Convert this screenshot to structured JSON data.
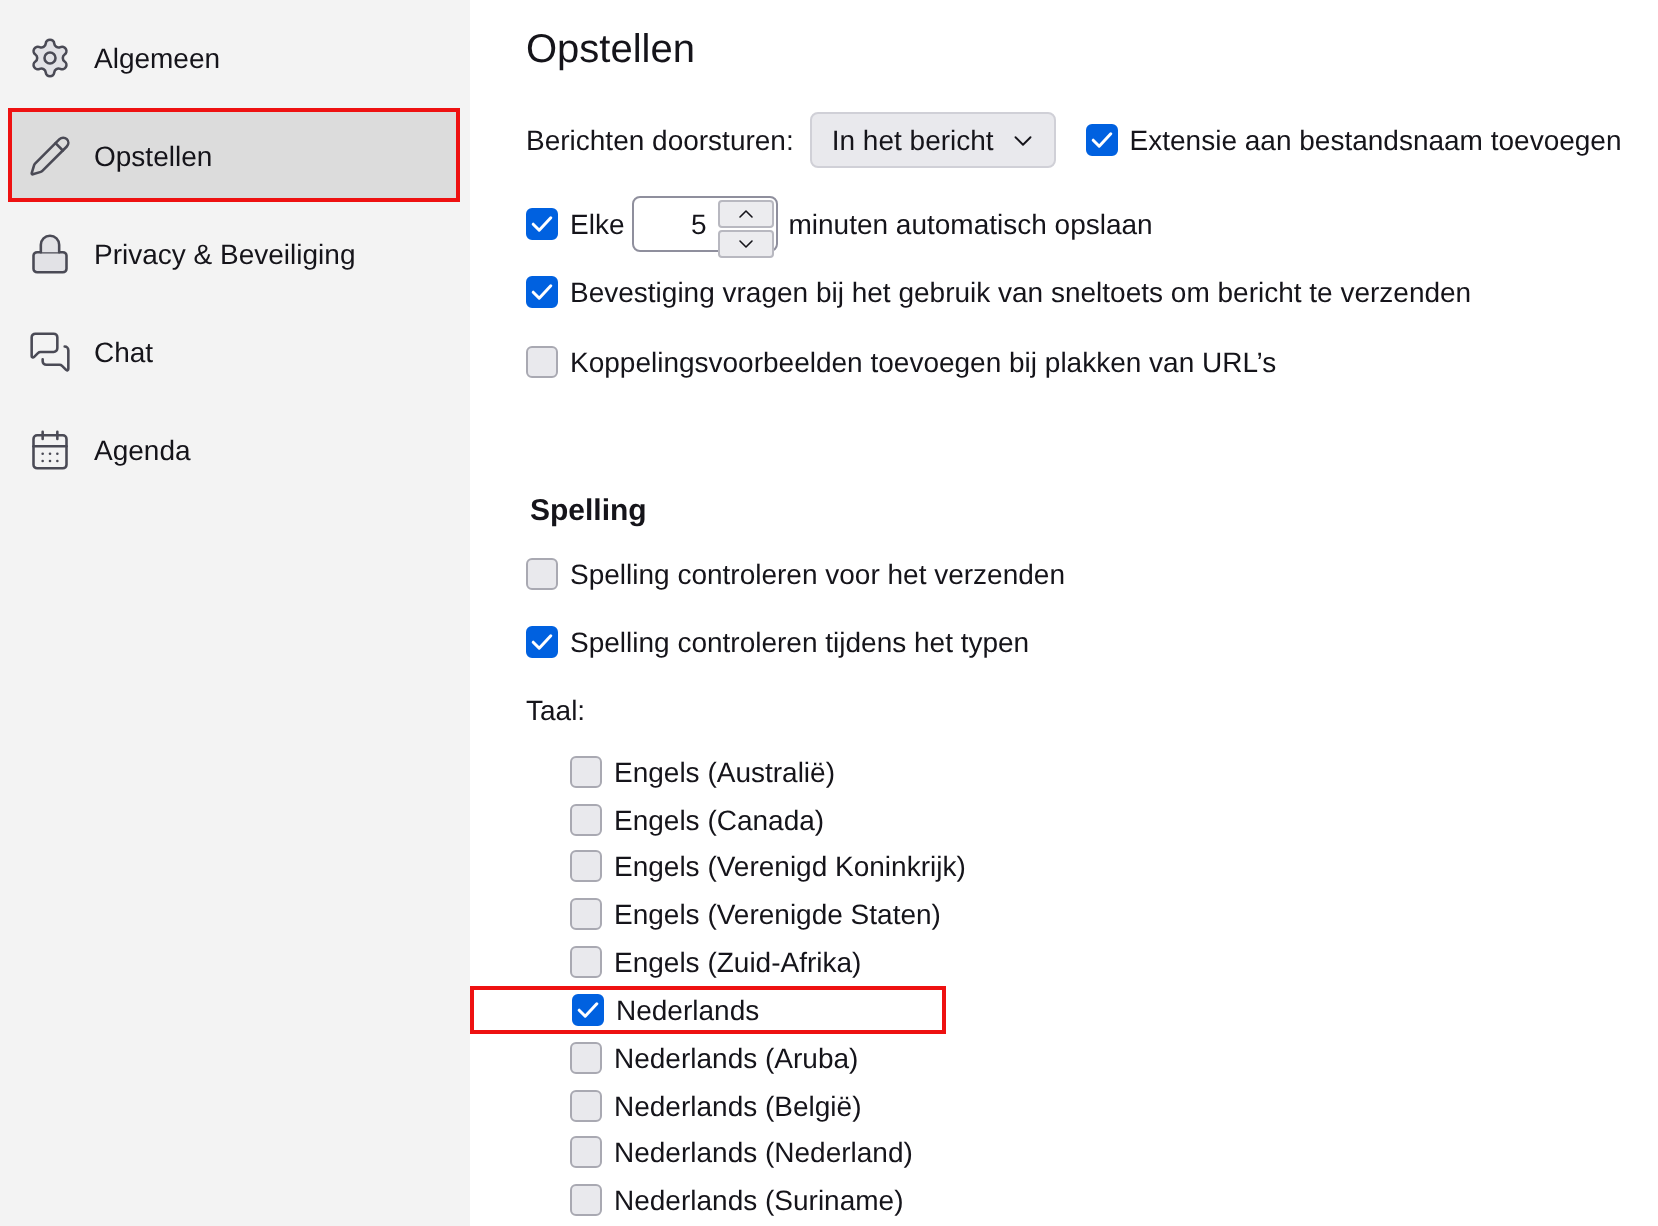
{
  "sidebar": {
    "items": [
      {
        "label": "Algemeen",
        "selected": false,
        "highlighted": false
      },
      {
        "label": "Opstellen",
        "selected": true,
        "highlighted": true
      },
      {
        "label": "Privacy & Beveiliging",
        "selected": false,
        "highlighted": false
      },
      {
        "label": "Chat",
        "selected": false,
        "highlighted": false
      },
      {
        "label": "Agenda",
        "selected": false,
        "highlighted": false
      }
    ]
  },
  "title": "Opstellen",
  "forwarding": {
    "label": "Berichten doorsturen:",
    "value": "In het bericht"
  },
  "extension_option": {
    "label": "Extensie aan bestandsnaam toevoegen",
    "checked": true
  },
  "autosave": {
    "label": "Elke",
    "checked": true,
    "value": "5",
    "suffix": "minuten automatisch opslaan"
  },
  "options": [
    {
      "label": "Bevestiging vragen bij het gebruik van sneltoets om bericht te verzenden",
      "checked": true
    },
    {
      "label": "Koppelingsvoorbeelden toevoegen bij plakken van URL’s",
      "checked": false
    }
  ],
  "spelling": {
    "heading": "Spelling",
    "options": [
      {
        "label": "Spelling controleren voor het verzenden",
        "checked": false
      },
      {
        "label": "Spelling controleren tijdens het typen",
        "checked": true
      }
    ],
    "language_label": "Taal:",
    "languages": [
      {
        "label": "Engels (Australië)",
        "checked": false,
        "highlighted": false
      },
      {
        "label": "Engels (Canada)",
        "checked": false,
        "highlighted": false
      },
      {
        "label": "Engels (Verenigd Koninkrijk)",
        "checked": false,
        "highlighted": false
      },
      {
        "label": "Engels (Verenigde Staten)",
        "checked": false,
        "highlighted": false
      },
      {
        "label": "Engels (Zuid-Afrika)",
        "checked": false,
        "highlighted": false
      },
      {
        "label": "Nederlands",
        "checked": true,
        "highlighted": true
      },
      {
        "label": "Nederlands (Aruba)",
        "checked": false,
        "highlighted": false
      },
      {
        "label": "Nederlands (België)",
        "checked": false,
        "highlighted": false
      },
      {
        "label": "Nederlands (Nederland)",
        "checked": false,
        "highlighted": false
      },
      {
        "label": "Nederlands (Suriname)",
        "checked": false,
        "highlighted": false
      }
    ]
  }
}
